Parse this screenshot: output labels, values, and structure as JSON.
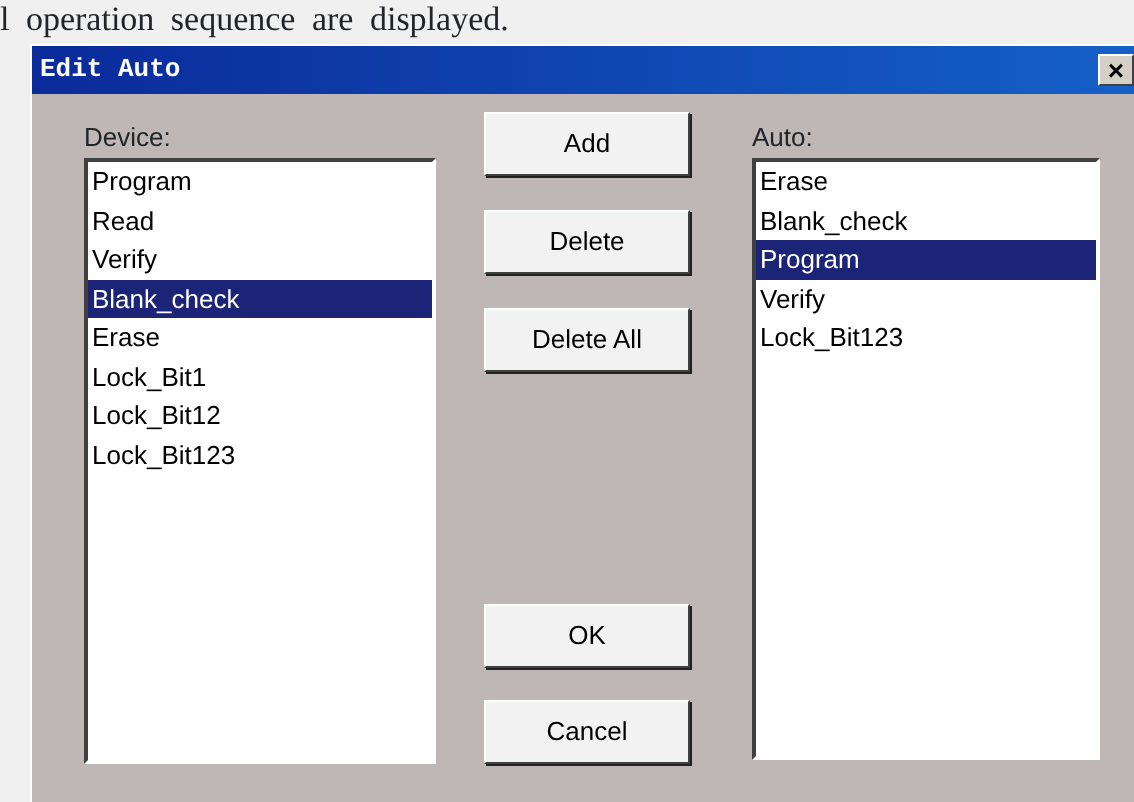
{
  "caption": "l operation sequence are displayed.",
  "window": {
    "title": "Edit Auto",
    "close": "×"
  },
  "device": {
    "label": "Device:",
    "items": [
      {
        "text": "Program",
        "selected": false
      },
      {
        "text": "Read",
        "selected": false
      },
      {
        "text": "Verify",
        "selected": false
      },
      {
        "text": "Blank_check",
        "selected": true
      },
      {
        "text": "Erase",
        "selected": false
      },
      {
        "text": "Lock_Bit1",
        "selected": false
      },
      {
        "text": "Lock_Bit12",
        "selected": false
      },
      {
        "text": "Lock_Bit123",
        "selected": false
      }
    ]
  },
  "actions": [
    "Add",
    "Delete",
    "Delete All"
  ],
  "auto": {
    "label": "Auto:",
    "items": [
      {
        "text": "Erase",
        "selected": false
      },
      {
        "text": "Blank_check",
        "selected": false
      },
      {
        "text": "Program",
        "selected": true
      },
      {
        "text": "Verify",
        "selected": false
      },
      {
        "text": "Lock_Bit123",
        "selected": false
      }
    ]
  },
  "buttons": [
    "OK",
    "Cancel"
  ]
}
